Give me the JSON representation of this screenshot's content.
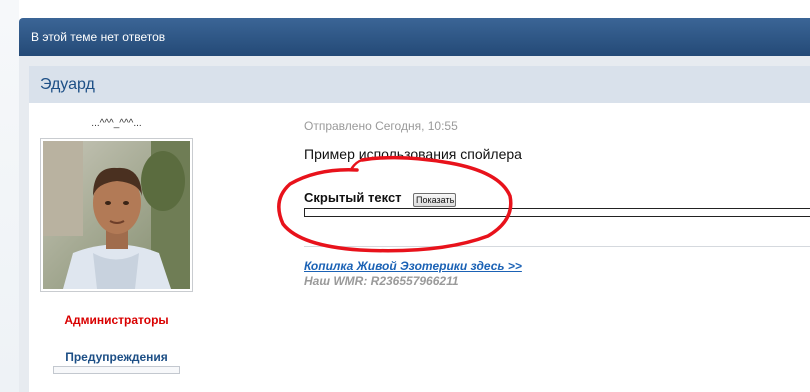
{
  "topic": {
    "status_text": "В этой теме нет ответов"
  },
  "author": {
    "name": "Эдуард",
    "nick": "...^^^_^^^...",
    "group": "Администраторы",
    "warnings_label": "Предупреждения",
    "avatar_icon": "person-photo"
  },
  "post": {
    "date": "Отправлено Сегодня, 10:55",
    "text": "Пример использования спойлера",
    "spoiler": {
      "title": "Скрытый текст",
      "button_label": "Показать"
    }
  },
  "signature": {
    "link_text": "Копилка Живой Эзотерики здесь >>",
    "wmr_text": "Наш WMR: R236557966211"
  },
  "colors": {
    "header_blue": "#2b5285",
    "author_bar": "#d9e1eb",
    "group_red": "#d90000",
    "link_blue": "#1b62b5",
    "annotation_red": "#e8121b"
  }
}
